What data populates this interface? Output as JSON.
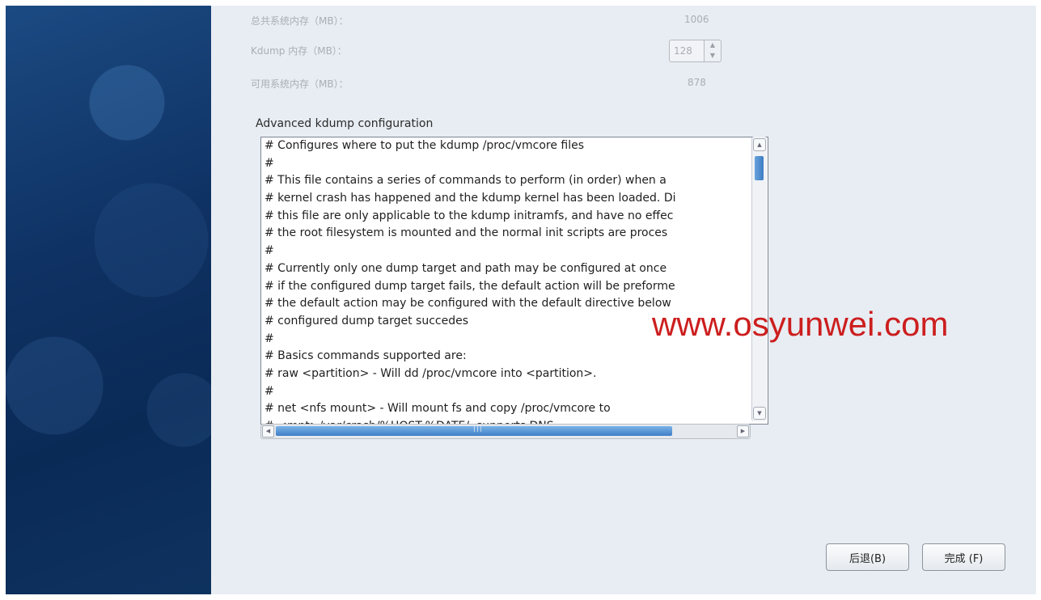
{
  "window": {
    "memory": {
      "total_label": "总共系统内存（MB）：",
      "total_value": "1006",
      "kdump_label": "Kdump 内存（MB）：",
      "kdump_value": "128",
      "available_label": "可用系统内存（MB）：",
      "available_value": "878"
    },
    "advanced": {
      "label": "Advanced kdump configuration",
      "lines": [
        "# Configures where to put the kdump /proc/vmcore files",
        "#",
        "# This file contains a series of commands to perform (in order) when a",
        "# kernel crash has happened and the kdump kernel has been loaded.  Di",
        "# this file are only applicable to the kdump initramfs, and have no effec",
        "# the root filesystem is mounted and the normal init scripts are proces",
        "#",
        "# Currently only one dump target and path may be configured at once",
        "# if the configured dump target fails, the default action will be preforme",
        "# the default action may be configured with the default directive below",
        "# configured dump target succedes",
        "#",
        "# Basics commands supported are:",
        "# raw <partition>  - Will dd /proc/vmcore into <partition>.",
        "#",
        "# net <nfs mount>        - Will mount fs and copy /proc/vmcore to",
        "#                    <mnt>/var/crash/%HOST-%DATE/, supports DNS."
      ]
    },
    "watermark": "www.osyunwei.com",
    "buttons": {
      "back": "后退(B)",
      "finish": "完成 (F)"
    }
  }
}
